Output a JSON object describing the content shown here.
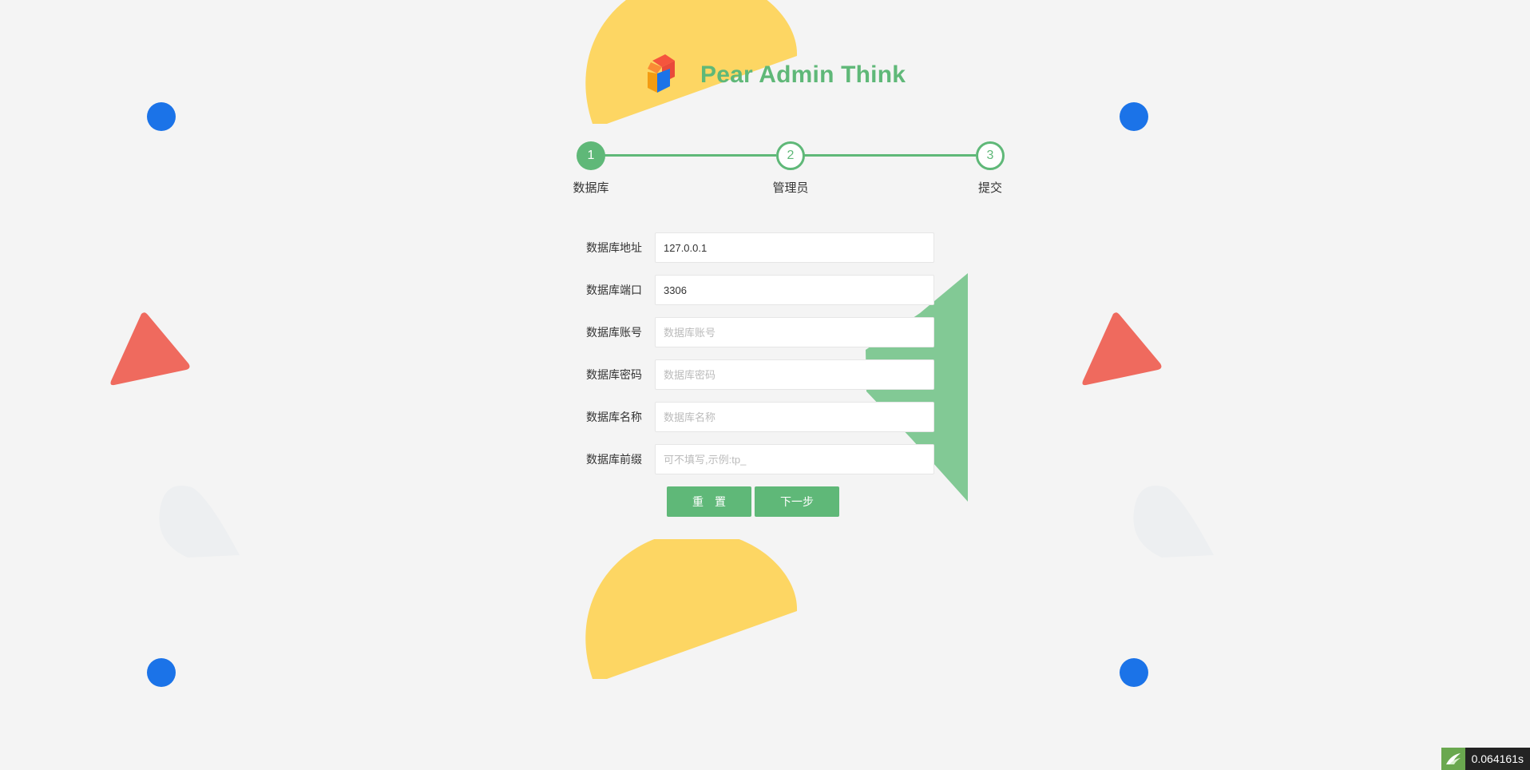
{
  "app": {
    "title": "Pear Admin Think",
    "logo_icon": "pear-cube-logo-icon"
  },
  "steps": [
    {
      "number": "1",
      "label": "数据库",
      "state": "active"
    },
    {
      "number": "2",
      "label": "管理员",
      "state": "pending"
    },
    {
      "number": "3",
      "label": "提交",
      "state": "pending"
    }
  ],
  "form": {
    "fields": [
      {
        "label": "数据库地址",
        "value": "127.0.0.1",
        "placeholder": ""
      },
      {
        "label": "数据库端口",
        "value": "3306",
        "placeholder": ""
      },
      {
        "label": "数据库账号",
        "value": "",
        "placeholder": "数据库账号"
      },
      {
        "label": "数据库密码",
        "value": "",
        "placeholder": "数据库密码"
      },
      {
        "label": "数据库名称",
        "value": "",
        "placeholder": "数据库名称"
      },
      {
        "label": "数据库前缀",
        "value": "",
        "placeholder": "可不填写,示例:tp_"
      }
    ],
    "reset_label": "重　置",
    "next_label": "下一步"
  },
  "debug": {
    "time": "0.064161s",
    "icon": "thinkphp-trace-icon"
  },
  "colors": {
    "accent": "#5fb878",
    "dot": "#1b73e8",
    "triangle": "#ef6a5e",
    "half_circle": "#fdd663",
    "background": "#f4f4f4"
  }
}
